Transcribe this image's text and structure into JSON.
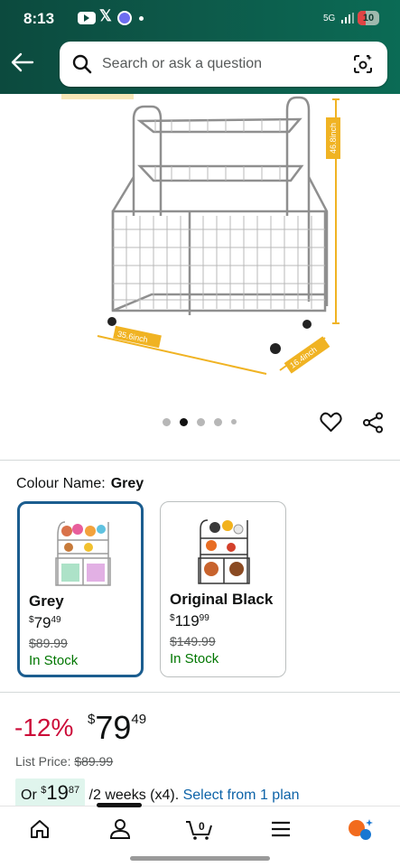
{
  "status": {
    "time": "8:13",
    "battery": "10",
    "network": "5G"
  },
  "search": {
    "placeholder": "Search or ask a question"
  },
  "gallery": {
    "dimension_height": "46.8inch",
    "dimension_width": "35.6inch",
    "dimension_depth": "16.4inch"
  },
  "colour": {
    "label": "Colour Name:",
    "value": "Grey"
  },
  "options": [
    {
      "name": "Grey",
      "price_symbol": "$",
      "price_whole": "79",
      "price_frac": "49",
      "was": "$89.99",
      "stock": "In Stock"
    },
    {
      "name": "Original Black",
      "price_symbol": "$",
      "price_whole": "119",
      "price_frac": "99",
      "was": "$149.99",
      "stock": "In Stock"
    }
  ],
  "pricing": {
    "discount": "-12%",
    "symbol": "$",
    "whole": "79",
    "frac": "49",
    "list_label": "List Price:",
    "list_value": "$89.99",
    "plan_or": "Or",
    "plan_symbol": "$",
    "plan_whole": "19",
    "plan_frac": "87",
    "plan_period": "/2 weeks (x4).",
    "plan_link": "Select from 1 plan"
  },
  "cart_count": "0",
  "colors": {
    "accent": "#0c4a3e",
    "link": "#0d63a8",
    "stock": "#007600",
    "discount": "#cc0c39",
    "selected": "#1b5d8f"
  }
}
